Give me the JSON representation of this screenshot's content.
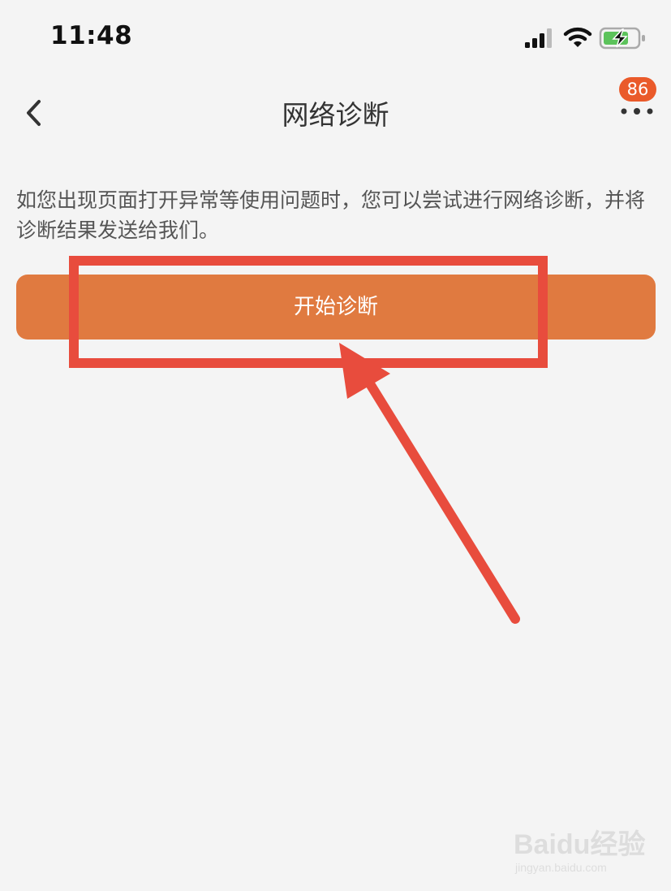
{
  "status_bar": {
    "time": "11:48",
    "icons": [
      "cellular-signal-icon",
      "wifi-icon",
      "battery-charging-icon"
    ],
    "battery_color": "#5cc35b"
  },
  "nav": {
    "back_icon": "chevron-left-icon",
    "title": "网络诊断",
    "more_icon": "more-dots-icon",
    "badge_count": "86",
    "badge_color": "#ea5a2a"
  },
  "content": {
    "description": "如您出现页面打开异常等使用问题时，您可以尝试进行网络诊断，并将诊断结果发送给我们。",
    "start_button_label": "开始诊断",
    "button_color": "#e07a40"
  },
  "annotation": {
    "highlight_color": "#e84c3d"
  },
  "watermark": {
    "logo_text": "Baidu经验",
    "url": "jingyan.baidu.com"
  }
}
